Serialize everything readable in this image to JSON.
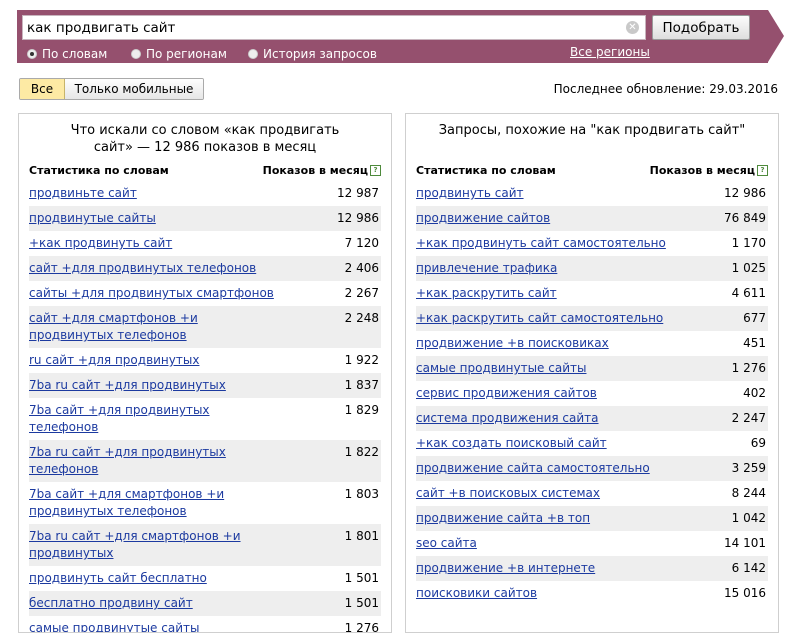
{
  "search": {
    "query": "как продвигать сайт",
    "button_label": "Подобрать"
  },
  "radio_options": [
    {
      "label": "По словам",
      "selected": true
    },
    {
      "label": "По регионам",
      "selected": false
    },
    {
      "label": "История запросов",
      "selected": false
    }
  ],
  "regions_link": "Все регионы",
  "filters": {
    "all": "Все",
    "mobile": "Только мобильные"
  },
  "last_update": "Последнее обновление: 29.03.2016",
  "left_panel": {
    "title_line1": "Что искали со словом «как продвигать",
    "title_line2": "сайт» — 12 986 показов в месяц",
    "col1": "Статистика по словам",
    "col2": "Показов в месяц",
    "rows": [
      {
        "phrase": "продвиньте сайт",
        "count": "12 987"
      },
      {
        "phrase": "продвинутые сайты",
        "count": "12 986"
      },
      {
        "phrase": "+как продвинуть сайт",
        "count": "7 120"
      },
      {
        "phrase": "сайт +для продвинутых телефонов",
        "count": "2 406"
      },
      {
        "phrase": "сайты +для продвинутых смартфонов",
        "count": "2 267"
      },
      {
        "phrase": "сайт +для смартфонов +и продвинутых телефонов",
        "count": "2 248"
      },
      {
        "phrase": "ru сайт +для продвинутых",
        "count": "1 922"
      },
      {
        "phrase": "7ba ru сайт +для продвинутых",
        "count": "1 837"
      },
      {
        "phrase": "7ba сайт +для продвинутых телефонов",
        "count": "1 829"
      },
      {
        "phrase": "7ba ru сайт +для продвинутых телефонов",
        "count": "1 822"
      },
      {
        "phrase": "7ba сайт +для смартфонов +и продвинутых телефонов",
        "count": "1 803"
      },
      {
        "phrase": "7ba ru сайт +для смартфонов +и продвинутых",
        "count": "1 801"
      },
      {
        "phrase": "продвинуть сайт бесплатно",
        "count": "1 501"
      },
      {
        "phrase": "бесплатно продвину сайт",
        "count": "1 501"
      },
      {
        "phrase": "самые продвинутые сайты",
        "count": "1 276"
      }
    ]
  },
  "right_panel": {
    "title": "Запросы, похожие на \"как продвигать сайт\"",
    "col1": "Статистика по словам",
    "col2": "Показов в месяц",
    "rows": [
      {
        "phrase": "продвинуть сайт",
        "count": "12 986"
      },
      {
        "phrase": "продвижение сайтов",
        "count": "76 849"
      },
      {
        "phrase": "+как продвинуть сайт самостоятельно",
        "count": "1 170"
      },
      {
        "phrase": "привлечение трафика",
        "count": "1 025"
      },
      {
        "phrase": "+как раскрутить сайт",
        "count": "4 611"
      },
      {
        "phrase": "+как раскрутить сайт самостоятельно",
        "count": "677"
      },
      {
        "phrase": "продвижение +в поисковиках",
        "count": "451"
      },
      {
        "phrase": "самые продвинутые сайты",
        "count": "1 276"
      },
      {
        "phrase": "сервис продвижения сайтов",
        "count": "402"
      },
      {
        "phrase": "система продвижения сайта",
        "count": "2 247"
      },
      {
        "phrase": "+как создать поисковый сайт",
        "count": "69"
      },
      {
        "phrase": "продвижение сайта самостоятельно",
        "count": "3 259"
      },
      {
        "phrase": "сайт +в поисковых системах",
        "count": "8 244"
      },
      {
        "phrase": "продвижение сайта +в топ",
        "count": "1 042"
      },
      {
        "phrase": "seo сайта",
        "count": "14 101"
      },
      {
        "phrase": "продвижение +в интернете",
        "count": "6 142"
      },
      {
        "phrase": "поисковики сайтов",
        "count": "15 016"
      }
    ]
  }
}
